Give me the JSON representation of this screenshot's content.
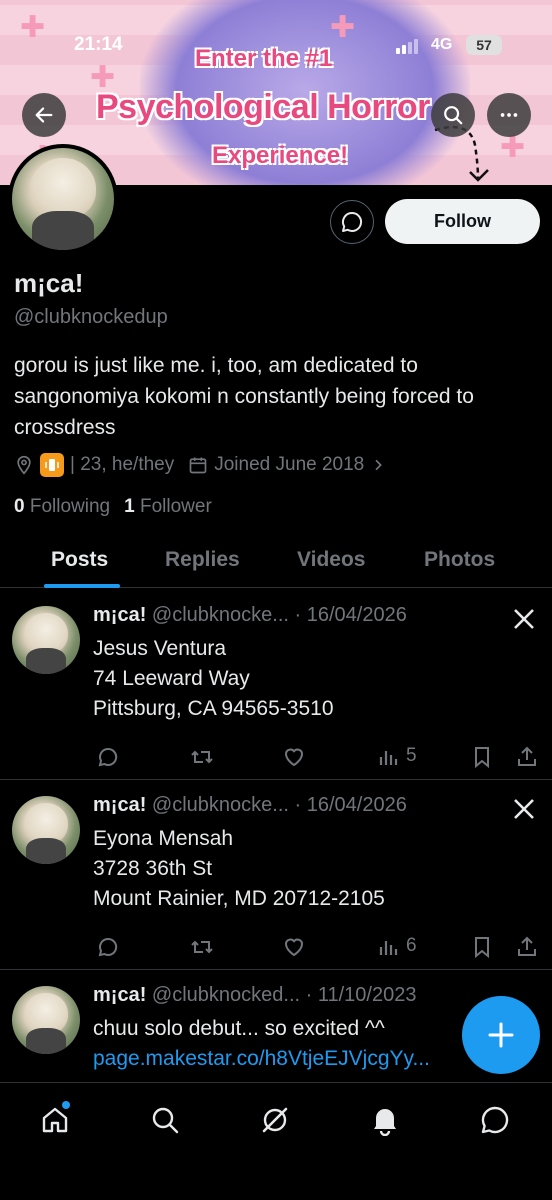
{
  "status_bar": {
    "time": "21:14",
    "network": "4G",
    "battery": "57"
  },
  "banner": {
    "line1": "Enter the #1",
    "line2": "Psychological Horror",
    "line3": "Experience!"
  },
  "profile": {
    "name": "m¡ca!",
    "handle": "@clubknockedup",
    "bio": "gorou is just like me. i, too, am dedicated to sangonomiya kokomi n constantly being forced to crossdress",
    "meta_text": "| 23, he/they",
    "joined": "Joined June 2018",
    "following_count": "0",
    "following_label": "Following",
    "followers_count": "1",
    "followers_label": "Follower",
    "follow_button": "Follow"
  },
  "tabs": [
    {
      "label": "Posts"
    },
    {
      "label": "Replies"
    },
    {
      "label": "Videos"
    },
    {
      "label": "Photos"
    }
  ],
  "posts": [
    {
      "name": "m¡ca!",
      "handle_date": "@clubknocke... · 16/04/2026",
      "line1": "Jesus Ventura",
      "line2": "74 Leeward Way",
      "line3": "Pittsburg, CA 94565-3510",
      "views": "5"
    },
    {
      "name": "m¡ca!",
      "handle_date": "@clubknocke... · 16/04/2026",
      "line1": "Eyona Mensah",
      "line2": "3728 36th St",
      "line3": "Mount Rainier, MD 20712-2105",
      "views": "6"
    },
    {
      "name": "m¡ca!",
      "handle_date": "@clubknocked... · 11/10/2023",
      "line1": "chuu solo debut... so excited ^^",
      "link": "page.makestar.co/h8VtjeEJVjcgYy..."
    }
  ],
  "colors": {
    "accent": "#1d9bf0",
    "muted": "#71767b",
    "text": "#e7e9ea"
  }
}
